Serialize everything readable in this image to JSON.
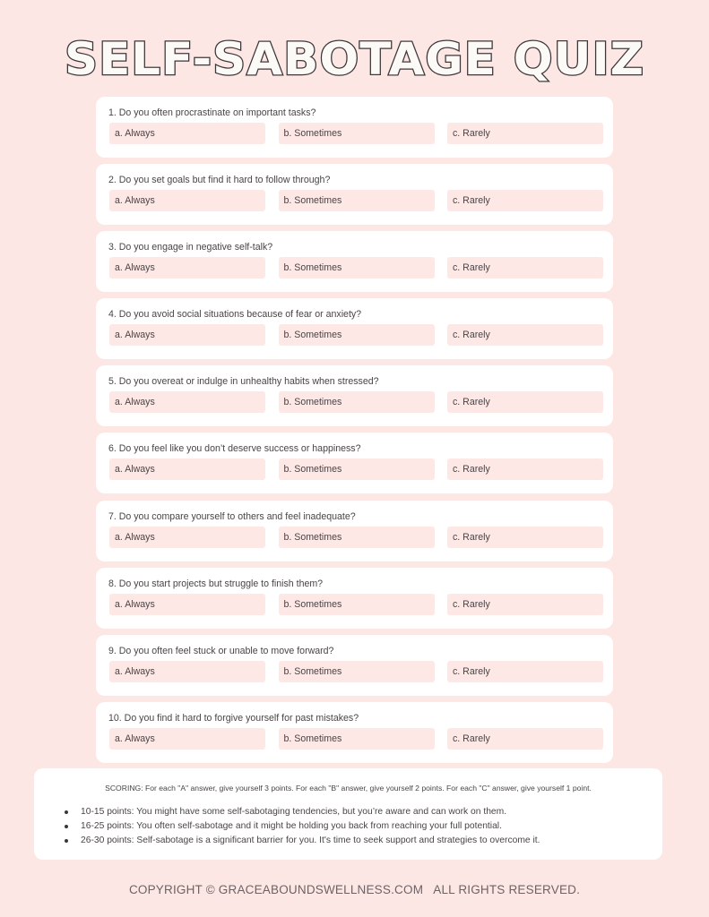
{
  "title": "SELF-SABOTAGE QUIZ",
  "questions": [
    {
      "text": "1. Do you often procrastinate on important tasks?",
      "options": [
        "a. Always",
        "b. Sometimes",
        "c. Rarely"
      ]
    },
    {
      "text": "2. Do you set goals but find it hard to follow through?",
      "options": [
        "a. Always",
        "b. Sometimes",
        "c. Rarely"
      ]
    },
    {
      "text": "3. Do you engage in negative self-talk?",
      "options": [
        "a. Always",
        "b. Sometimes",
        "c. Rarely"
      ]
    },
    {
      "text": "4. Do you avoid social situations because of fear or anxiety?",
      "options": [
        "a. Always",
        "b. Sometimes",
        "c. Rarely"
      ]
    },
    {
      "text": "5. Do you overeat or indulge in unhealthy habits when stressed?",
      "options": [
        "a. Always",
        "b. Sometimes",
        "c. Rarely"
      ]
    },
    {
      "text": "6. Do you feel like you don’t deserve success or happiness?",
      "options": [
        "a. Always",
        "b. Sometimes",
        "c. Rarely"
      ]
    },
    {
      "text": "7. Do you compare yourself to others and feel inadequate?",
      "options": [
        "a. Always",
        "b. Sometimes",
        "c. Rarely"
      ]
    },
    {
      "text": "8. Do you start projects but struggle to finish them?",
      "options": [
        "a. Always",
        "b. Sometimes",
        "c. Rarely"
      ]
    },
    {
      "text": "9. Do you often feel stuck or unable to move forward?",
      "options": [
        "a. Always",
        "b. Sometimes",
        "c. Rarely"
      ]
    },
    {
      "text": "10. Do you find it hard to forgive yourself for past mistakes?",
      "options": [
        "a. Always",
        "b. Sometimes",
        "c. Rarely"
      ]
    }
  ],
  "scoring": {
    "intro": "SCORING: For each \"A\" answer, give yourself 3 points. For each \"B\" answer, give yourself 2 points. For each \"C\" answer, give yourself 1 point.",
    "ranges": [
      "10-15 points: You might have some self-sabotaging tendencies, but you’re aware and can work on them.",
      "16-25 points: You often self-sabotage and it might be holding you back from reaching your full potential.",
      "26-30 points: Self-sabotage is a significant barrier for you. It's time to seek support and strategies to overcome it."
    ]
  },
  "footer": "COPYRIGHT © GRACEABOUNDSWELLNESS.COM   ALL RIGHTS RESERVED.",
  "colors": {
    "background": "#fde7e5",
    "card": "#ffffff",
    "option_chip": "#fde8e6",
    "text": "#4a4446",
    "title_outline": "#3d3739"
  }
}
